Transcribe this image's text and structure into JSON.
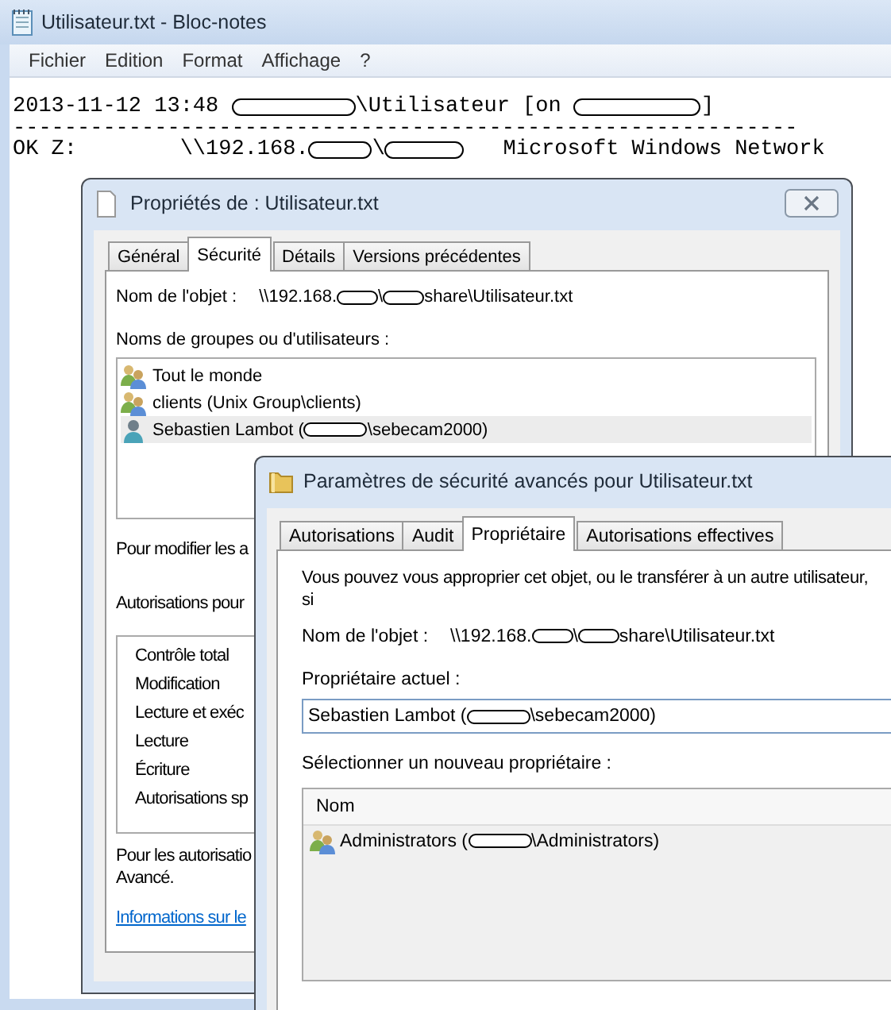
{
  "notepad": {
    "title": "Utilisateur.txt - Bloc-notes",
    "menu": [
      "Fichier",
      "Edition",
      "Format",
      "Affichage",
      "?"
    ],
    "lines": [
      {
        "parts": [
          "2013-11-12 13:48 ",
          "\\Utilisateur [on ",
          "]"
        ]
      },
      {
        "parts": [
          "-------------------------------------------------------------"
        ]
      },
      {
        "parts": [
          "OK Z:        \\\\192.168.",
          "\\",
          "   Microsoft Windows Network"
        ]
      }
    ]
  },
  "properties": {
    "title": "Propriétés de : Utilisateur.txt",
    "tabs": [
      {
        "label": "Général",
        "selected": false
      },
      {
        "label": "Sécurité",
        "selected": true
      },
      {
        "label": "Détails",
        "selected": false
      },
      {
        "label": "Versions précédentes",
        "selected": false
      }
    ],
    "object_label": "Nom de l'objet :",
    "object_path": [
      "\\\\192.168.",
      "\\",
      "share\\Utilisateur.txt"
    ],
    "groups_label": "Noms de groupes ou d'utilisateurs :",
    "groups": [
      {
        "kind": "group",
        "parts": [
          "Tout le monde"
        ],
        "selected": false
      },
      {
        "kind": "group",
        "parts": [
          "clients (Unix Group\\clients)"
        ],
        "selected": false
      },
      {
        "kind": "user",
        "parts": [
          "Sebastien Lambot (",
          "\\sebecam2000)"
        ],
        "selected": true
      }
    ],
    "modify_text": "Pour modifier les a",
    "permissions_label": "Autorisations pour",
    "permissions": [
      "Contrôle total",
      "Modification",
      "Lecture et exéc",
      "Lecture",
      "Écriture",
      "Autorisations sp"
    ],
    "special_text": [
      "Pour les autorisatio",
      "Avancé."
    ],
    "link": "Informations sur le"
  },
  "advanced": {
    "title": "Paramètres de sécurité avancés pour Utilisateur.txt",
    "tabs": [
      {
        "label": "Autorisations",
        "selected": false
      },
      {
        "label": "Audit",
        "selected": false
      },
      {
        "label": "Propriétaire",
        "selected": true
      },
      {
        "label": "Autorisations effectives",
        "selected": false
      }
    ],
    "intro": "Vous pouvez vous approprier cet objet, ou le transférer à un autre utilisateur, si",
    "object_label": "Nom de l'objet :",
    "object_path": [
      "\\\\192.168.",
      "\\",
      "share\\Utilisateur.txt"
    ],
    "current_owner_label": "Propriétaire actuel :",
    "current_owner": [
      "Sebastien Lambot (",
      "\\sebecam2000)"
    ],
    "new_owner_label": "Sélectionner un nouveau propriétaire :",
    "columns": [
      "Nom"
    ],
    "owners": [
      {
        "kind": "group",
        "parts": [
          "Administrators (",
          "\\Administrators)"
        ]
      }
    ]
  }
}
